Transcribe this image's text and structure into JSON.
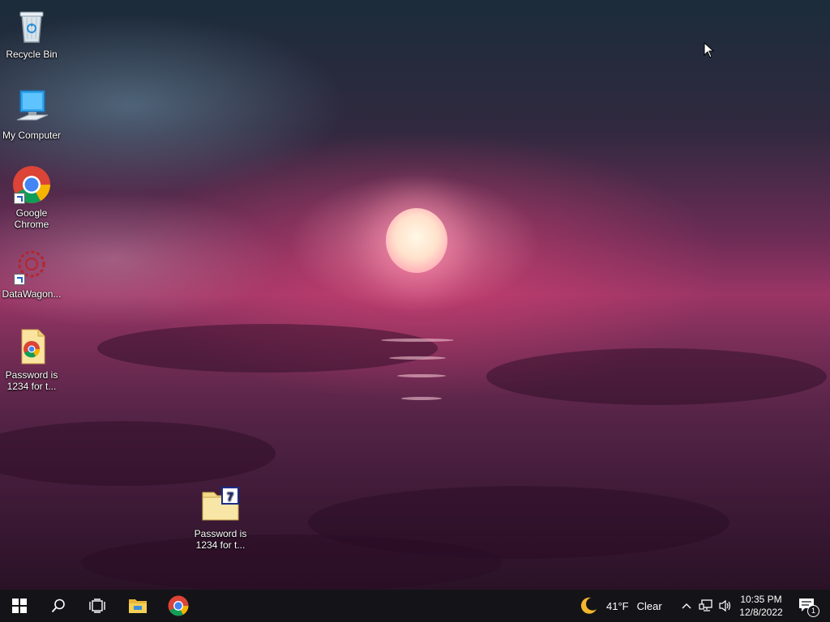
{
  "desktop": {
    "icons": [
      {
        "label": "Recycle Bin",
        "icon": "recycle-bin-icon"
      },
      {
        "label": "My Computer",
        "icon": "computer-icon"
      },
      {
        "label": "Google Chrome",
        "icon": "chrome-icon"
      },
      {
        "label": "DataWagon...",
        "icon": "datawagon-icon"
      },
      {
        "label": "Password is 1234 for t...",
        "icon": "chrome-html-file-icon"
      },
      {
        "label": "Password is 1234 for t...",
        "icon": "7zip-archive-icon"
      }
    ]
  },
  "taskbar": {
    "start": "windows-start-icon",
    "search": "search-icon",
    "task_view": "task-view-icon",
    "pinned": [
      {
        "icon": "file-explorer-icon"
      },
      {
        "icon": "chrome-icon"
      }
    ],
    "weather": {
      "temp": "41°F",
      "condition": "Clear",
      "icon": "moon-icon"
    },
    "tray_icons": [
      "chevron-up-icon",
      "network-icon",
      "volume-icon"
    ],
    "clock": {
      "time": "10:35 PM",
      "date": "12/8/2022"
    },
    "notifications": {
      "count": "1",
      "icon": "action-center-icon"
    }
  },
  "colors": {
    "taskbar_bg": "#141418",
    "chrome_red": "#db4437",
    "chrome_green": "#0f9d58",
    "chrome_yellow": "#f4b400",
    "chrome_blue": "#4285f4",
    "windows_blue": "#ffffff"
  }
}
